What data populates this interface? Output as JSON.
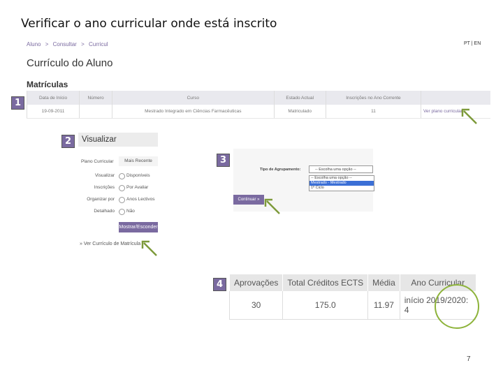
{
  "slide": {
    "title": "Verificar o ano curricular onde está inscrito",
    "page_number": "7"
  },
  "breadcrumb": [
    "Aluno",
    ">",
    "Consultar",
    ">",
    "Curricul"
  ],
  "lang": "PT | EN",
  "page_title": "Currículo do Aluno",
  "section_title": "Matrículas",
  "matriculas_table": {
    "headers": [
      "Data de Início",
      "Número",
      "Curso",
      "Estado Actual",
      "Inscrições no Ano Corrente",
      ""
    ],
    "row": [
      "19-09-2011",
      "",
      "Mestrado Integrado em Ciências Farmacêuticas",
      "Matriculado",
      "11",
      "Ver plano curricular"
    ]
  },
  "steps": [
    "1",
    "2",
    "3",
    "4"
  ],
  "panel2": {
    "title": "Visualizar",
    "plan_label": "Plano Curricular",
    "tab": "Mais Recente",
    "options": [
      {
        "label": "Visualizar",
        "value": "Disponíveis"
      },
      {
        "label": "Inscrições",
        "value": "Por Avaliar"
      },
      {
        "label": "Organizar por",
        "value": "Anos Lectivos"
      },
      {
        "label": "Detalhado",
        "value": "Não"
      }
    ],
    "button": "Mostrar/Esconder",
    "link": "» Ver Currículo de Matrícula"
  },
  "panel3": {
    "label": "Tipo de Agrupamento:",
    "select_value": "-- Escolha uma opção --",
    "options": [
      "-- Escolha uma opção --",
      "Mestrado - Mestrado",
      "1º Ciclo"
    ],
    "selected_index": 1,
    "button": "Continuar »"
  },
  "results_table": {
    "headers": [
      "Aprovações",
      "Total Créditos ECTS",
      "Média",
      "Ano Curricular"
    ],
    "row": [
      "30",
      "175.0",
      "11.97",
      "início 2019/2020: 4"
    ]
  },
  "colors": {
    "accent": "#7a6aa0",
    "highlight": "#8db33a"
  },
  "icons": [
    "arrow-pointer-icon"
  ]
}
